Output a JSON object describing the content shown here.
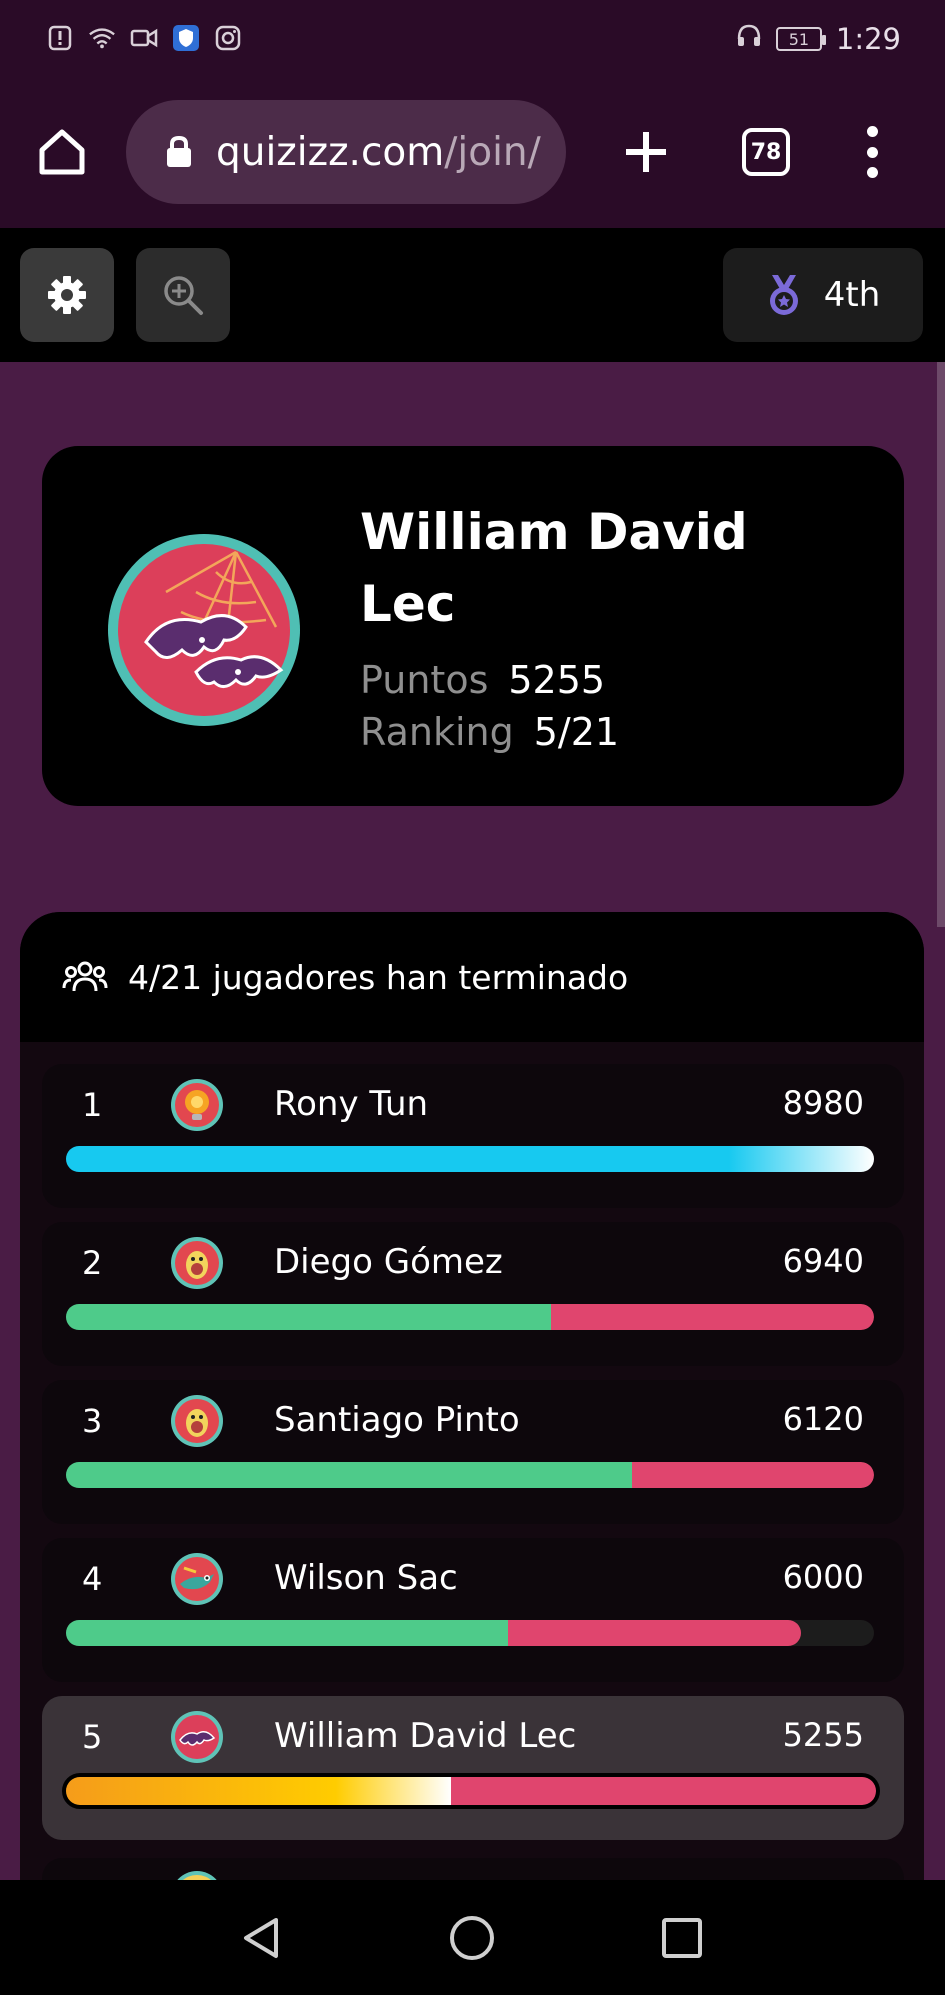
{
  "status_bar": {
    "time": "1:29",
    "battery": "51"
  },
  "browser": {
    "url_domain": "quizizz.com",
    "url_path": "/join/",
    "tab_count": "78"
  },
  "quiz_toolbar": {
    "rank_label": "4th"
  },
  "profile": {
    "name": "William David Lec",
    "points_label": "Puntos",
    "points": "5255",
    "ranking_label": "Ranking",
    "ranking": "5/21"
  },
  "leaderboard": {
    "header": "4/21 jugadores han terminado",
    "rows": [
      {
        "rank": "1",
        "name": "Rony Tun",
        "score": "8980",
        "correct": 1.0,
        "incorrect": 0.0,
        "avatar": "lightbulb-avatar",
        "bar": "cyan"
      },
      {
        "rank": "2",
        "name": "Diego Gómez",
        "score": "6940",
        "correct": 0.6,
        "incorrect": 0.4,
        "avatar": "avocado-avatar",
        "bar": "green"
      },
      {
        "rank": "3",
        "name": "Santiago Pinto",
        "score": "6120",
        "correct": 0.7,
        "incorrect": 0.3,
        "avatar": "avocado-avatar",
        "bar": "green"
      },
      {
        "rank": "4",
        "name": "Wilson Sac",
        "score": "6000",
        "correct": 0.547,
        "incorrect": 0.363,
        "avatar": "bird-avatar",
        "bar": "green"
      },
      {
        "rank": "5",
        "name": "William David Lec",
        "score": "5255",
        "correct": 0.475,
        "incorrect": 0.525,
        "avatar": "bat-avatar",
        "bar": "orange",
        "is_me": true
      }
    ]
  },
  "colors": {
    "correct": "#4ecb8a",
    "incorrect": "#e0456e",
    "leader": "#17c9f0",
    "me": "#f59c1a",
    "background": "#4a1c45"
  }
}
